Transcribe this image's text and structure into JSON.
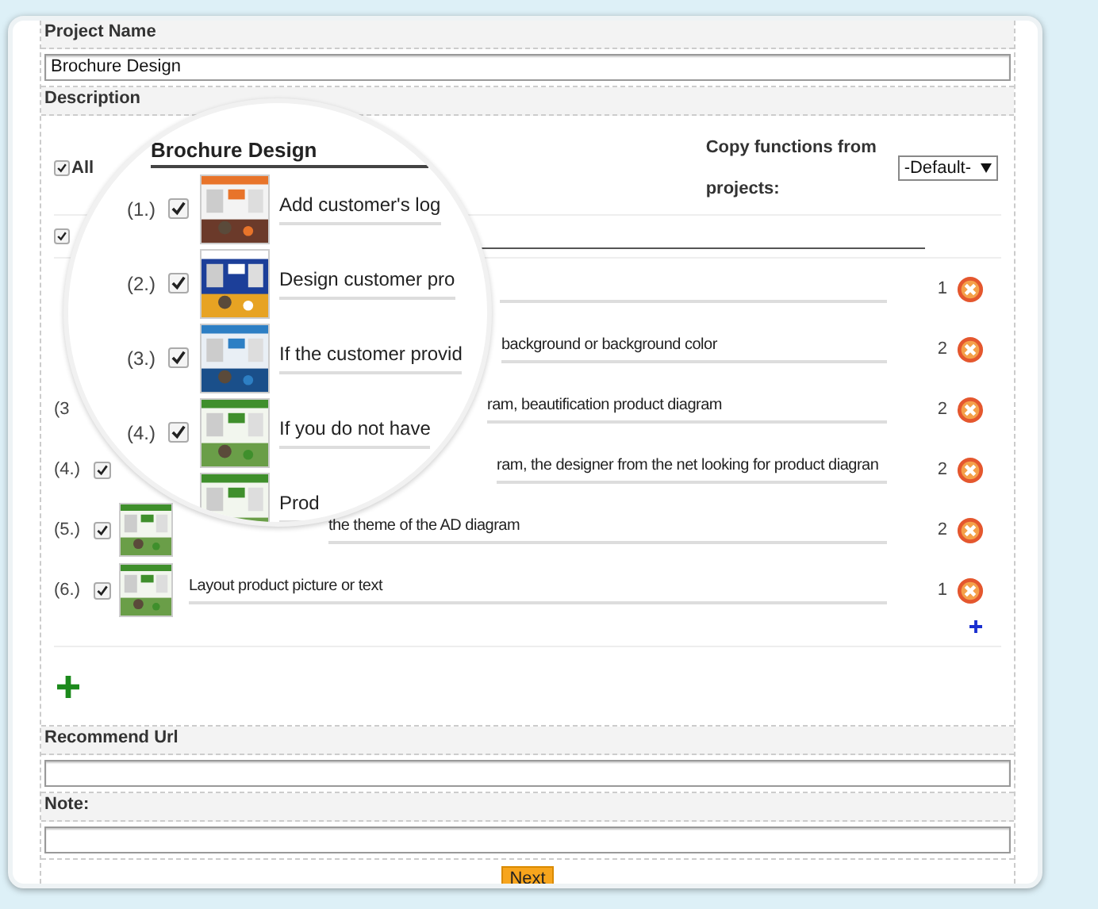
{
  "project_name": {
    "label": "Project Name",
    "value": "Brochure Design"
  },
  "description": {
    "label": "Description"
  },
  "all_checkbox": {
    "label": "All",
    "checked": true
  },
  "copy_functions": {
    "label_line_1": "Copy functions from",
    "label_line_2": "projects:",
    "select_value": "-Default-"
  },
  "title_row": {
    "checked": true
  },
  "items": [
    {
      "count": "1"
    },
    {
      "text": "background or background color",
      "count": "2"
    },
    {
      "number": "(3",
      "text": "ram, beautification product diagram",
      "count": "2"
    },
    {
      "number": "(4.)",
      "checked": true,
      "text": "ram, the designer from the net looking for product diagran",
      "count": "2"
    },
    {
      "number": "(5.)",
      "checked": true,
      "text": "the theme of the AD diagram",
      "count": "2"
    },
    {
      "number": "(6.)",
      "checked": true,
      "text": "Layout product picture or text",
      "count": "1"
    }
  ],
  "magnifier": {
    "title": "Brochure Design",
    "items": [
      {
        "number": "(1.)",
        "checked": true,
        "text": "Add customer's log"
      },
      {
        "number": "(2.)",
        "checked": true,
        "text": "Design  customer pro"
      },
      {
        "number": "(3.)",
        "checked": true,
        "text": "If the customer provid"
      },
      {
        "number": "(4.)",
        "checked": true,
        "text": "If you do not have"
      },
      {
        "text": "Prod"
      }
    ]
  },
  "recommend_url": {
    "label": "Recommend Url"
  },
  "note": {
    "label": "Note:"
  },
  "next_button": {
    "label": "Next"
  }
}
